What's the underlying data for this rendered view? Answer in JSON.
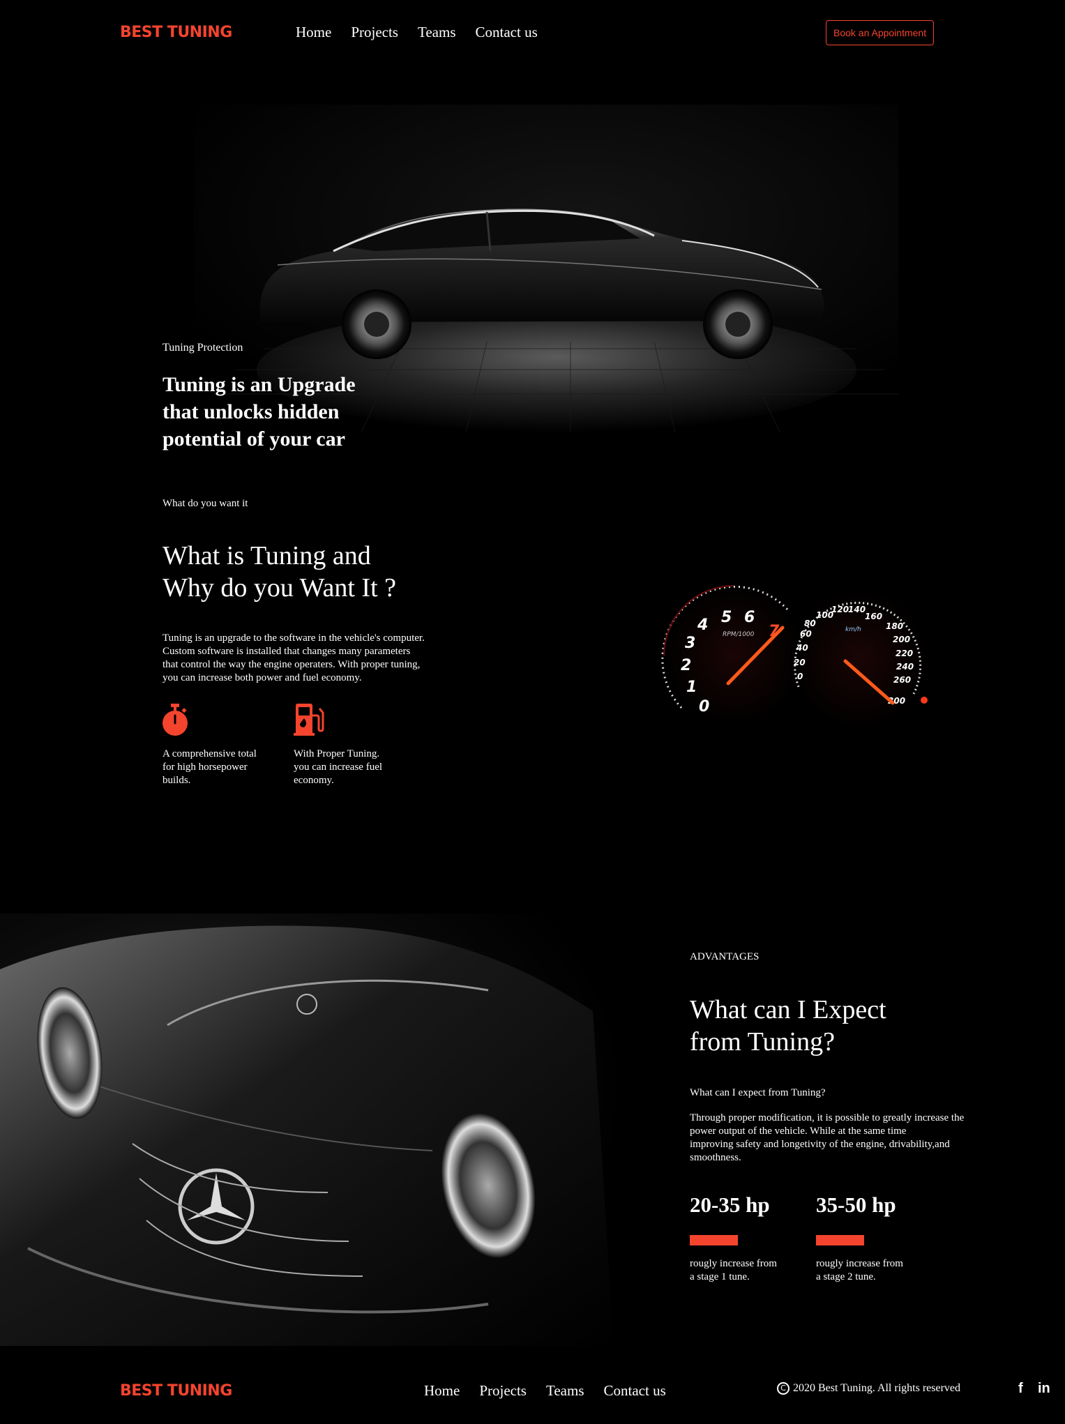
{
  "brand": {
    "logo": "BEST TUNING",
    "accent_color": "#f4442e"
  },
  "nav": {
    "items": [
      {
        "label": "Home"
      },
      {
        "label": "Projects"
      },
      {
        "label": "Teams"
      },
      {
        "label": "Contact us"
      }
    ],
    "cta_label": "Book an Appointment"
  },
  "hero": {
    "eyebrow": "Tuning Protection",
    "title_lines": [
      "Tuning is an Upgrade",
      "that unlocks hidden",
      "potential of your car"
    ]
  },
  "about": {
    "eyebrow": "What do you want it",
    "title_lines": [
      "What is Tuning and",
      "Why do you Want It ?"
    ],
    "paragraph_lines": [
      "Tuning is an upgrade to the software in the vehicle's computer.",
      "Custom software is installed that changes many parameters",
      "that control the way the engine operaters. With proper tuning,",
      "you can increase both power and fuel economy."
    ],
    "features": [
      {
        "icon": "stopwatch-icon",
        "lines": [
          "A comprehensive total",
          "for high horsepower",
          "builds."
        ]
      },
      {
        "icon": "fuel-pump-icon",
        "lines": [
          "With Proper Tuning.",
          "you can increase fuel",
          "economy."
        ]
      }
    ],
    "gauges": {
      "tach_numbers": [
        "0",
        "1",
        "2",
        "3",
        "4",
        "5",
        "6",
        "7"
      ],
      "tach_caption": "RPM/1000",
      "speed_numbers": [
        "0",
        "20",
        "40",
        "60",
        "80",
        "100",
        "120",
        "140",
        "160",
        "180",
        "200",
        "220",
        "240",
        "260",
        "300"
      ],
      "speed_caption": "km/h"
    }
  },
  "advantages": {
    "eyebrow": "ADVANTAGES",
    "title_lines": [
      "What can I Expect",
      "from Tuning?"
    ],
    "subheading": "What can I expect from Tuning?",
    "paragraph_lines": [
      "Through proper modification, it is possible to greatly increase the",
      "power output of the vehicle. While at the same time",
      "improving safety and longetivity of the engine, drivability,and",
      "smoothness."
    ],
    "stats": [
      {
        "value": "20-35 hp",
        "lines": [
          "rougly increase from",
          "a stage 1 tune."
        ]
      },
      {
        "value": "35-50 hp",
        "lines": [
          "rougly increase from",
          "a stage 2 tune."
        ]
      }
    ]
  },
  "footer": {
    "logo": "BEST TUNING",
    "nav": [
      {
        "label": "Home"
      },
      {
        "label": "Projects"
      },
      {
        "label": "Teams"
      },
      {
        "label": "Contact us"
      }
    ],
    "copyright": "2020 Best Tuning. All rights reserved",
    "social": [
      {
        "icon": "facebook-icon",
        "label": "f"
      },
      {
        "icon": "linkedin-icon",
        "label": "in"
      }
    ]
  }
}
